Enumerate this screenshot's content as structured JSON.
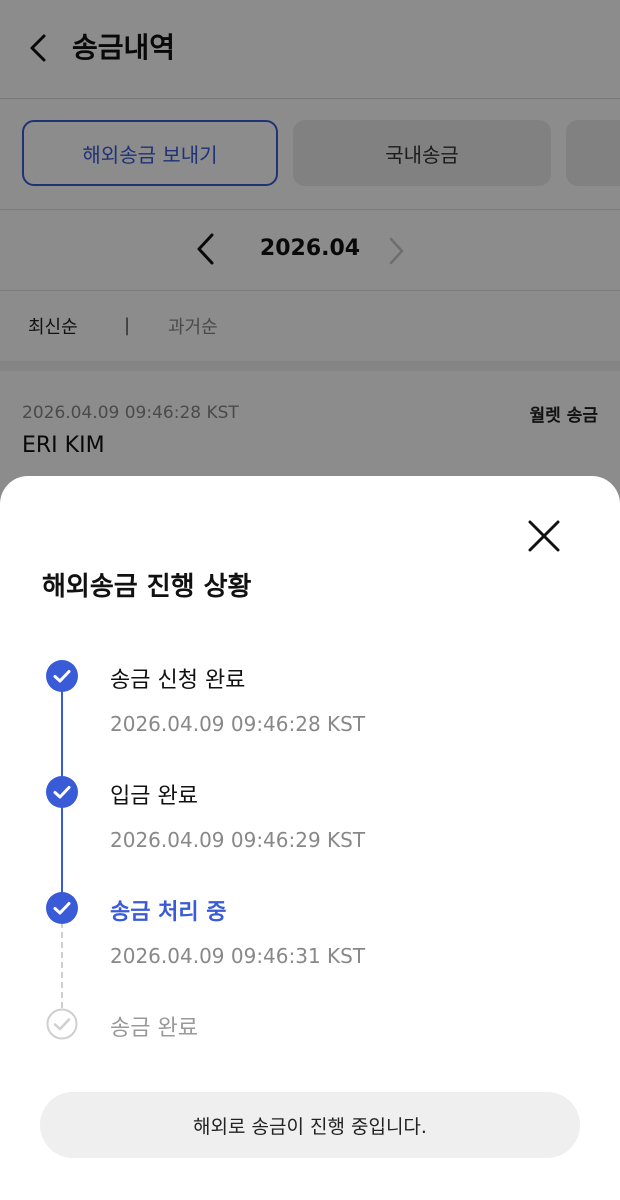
{
  "header": {
    "title": "송금내역",
    "back_icon": "chevron-left-icon"
  },
  "tabs": [
    {
      "label": "해외송금 보내기",
      "active": true
    },
    {
      "label": "국내송금",
      "active": false
    },
    {
      "label": "",
      "active": false
    }
  ],
  "month_nav": {
    "label": "2026.04",
    "prev_icon": "chevron-left-icon",
    "next_icon": "chevron-right-icon",
    "next_disabled": true
  },
  "sort": {
    "latest": "최신순",
    "divider": "|",
    "oldest": "과거순"
  },
  "transaction": {
    "time": "2026.04.09 09:46:28 KST",
    "type": "월렛 송금",
    "name": "ERI KIM"
  },
  "sheet": {
    "title": "해외송금 진행 상황",
    "close_icon": "close-icon",
    "steps": [
      {
        "label": "송금 신청 완료",
        "time": "2026.04.09 09:46:28 KST",
        "status": "done"
      },
      {
        "label": "입금 완료",
        "time": "2026.04.09 09:46:29 KST",
        "status": "done"
      },
      {
        "label": "송금 처리 중",
        "time": "2026.04.09 09:46:31 KST",
        "status": "current"
      },
      {
        "label": "송금 완료",
        "time": "",
        "status": "pending"
      }
    ],
    "notice": "해외로 송금이 진행 중입니다."
  },
  "colors": {
    "accent": "#3a5bd8",
    "dim_overlay": "rgba(0,0,0,0.45)",
    "pending": "#cfcfcf"
  }
}
